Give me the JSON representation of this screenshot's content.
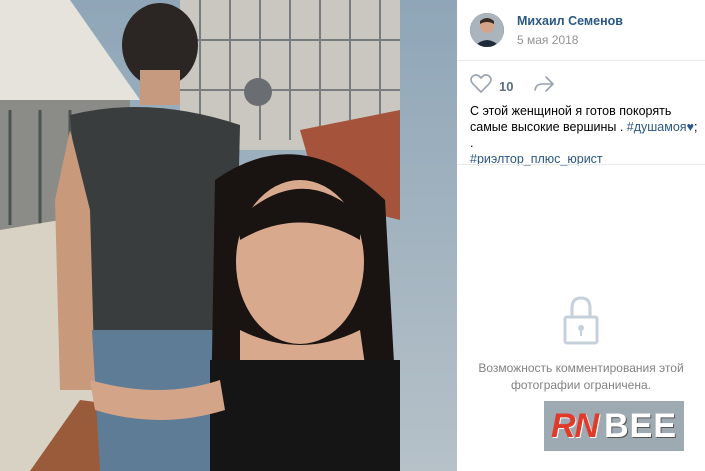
{
  "post": {
    "author_name": "Михаил Семенов",
    "date": "5 мая 2018",
    "likes": "10",
    "caption_text": "С этой женщиной я готов покорять самые высокие вершины . ",
    "hashtag_1": "#душамоя",
    "heart": "♥",
    "separator": "; .",
    "hashtag_2": "#риэлтор_плюс_юрист"
  },
  "comments": {
    "restricted_text": "Возможность комментирования этой фотографии ограничена."
  },
  "watermark": {
    "part_1": "RN",
    "part_2": "BEE"
  },
  "icons": {
    "like": "heart-outline-icon",
    "share": "share-arrow-icon",
    "lock": "lock-icon"
  },
  "colors": {
    "link": "#2a5885",
    "muted": "#939393",
    "watermark_red": "#e03a2a"
  }
}
